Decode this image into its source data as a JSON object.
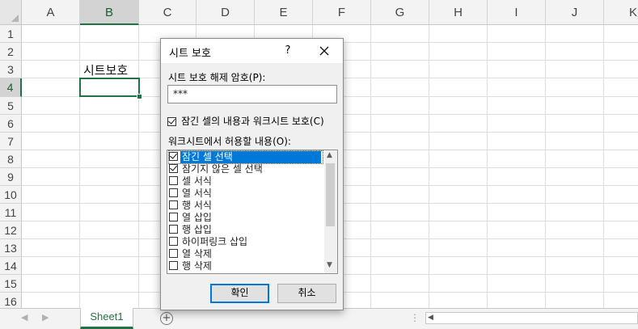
{
  "spreadsheet": {
    "columns": [
      "A",
      "B",
      "C",
      "D",
      "E",
      "F",
      "G",
      "H",
      "I",
      "J",
      "K"
    ],
    "rows": [
      "1",
      "2",
      "3",
      "4",
      "5",
      "6",
      "7",
      "8",
      "9",
      "10",
      "11",
      "12",
      "13",
      "14",
      "15",
      "16"
    ],
    "selected_column": "B",
    "selected_row": "4",
    "cell_b3_text": "시트보호",
    "sheet_tab": "Sheet1",
    "add_sheet_symbol": "+",
    "nav_left": "◀",
    "nav_right": "▶",
    "more_symbol": "⋮"
  },
  "dialog": {
    "title": "시트 보호",
    "help_label": "?",
    "password_label": "시트 보호 해제 암호(P):",
    "password_value": "***",
    "protect_checkbox_label": "잠긴 셀의 내용과 워크시트 보호(C)",
    "protect_checked": true,
    "allow_label": "워크시트에서 허용할 내용(O):",
    "permissions": [
      {
        "label": "잠긴 셀 선택",
        "checked": true,
        "selected": true
      },
      {
        "label": "잠기지 않은 셀 선택",
        "checked": true,
        "selected": false
      },
      {
        "label": "셀 서식",
        "checked": false,
        "selected": false
      },
      {
        "label": "열 서식",
        "checked": false,
        "selected": false
      },
      {
        "label": "행 서식",
        "checked": false,
        "selected": false
      },
      {
        "label": "열 삽입",
        "checked": false,
        "selected": false
      },
      {
        "label": "행 삽입",
        "checked": false,
        "selected": false
      },
      {
        "label": "하이퍼링크 삽입",
        "checked": false,
        "selected": false
      },
      {
        "label": "열 삭제",
        "checked": false,
        "selected": false
      },
      {
        "label": "행 삭제",
        "checked": false,
        "selected": false
      }
    ],
    "ok_label": "확인",
    "cancel_label": "취소"
  },
  "colors": {
    "excel_green": "#217346",
    "selection_blue": "#0078d7"
  }
}
